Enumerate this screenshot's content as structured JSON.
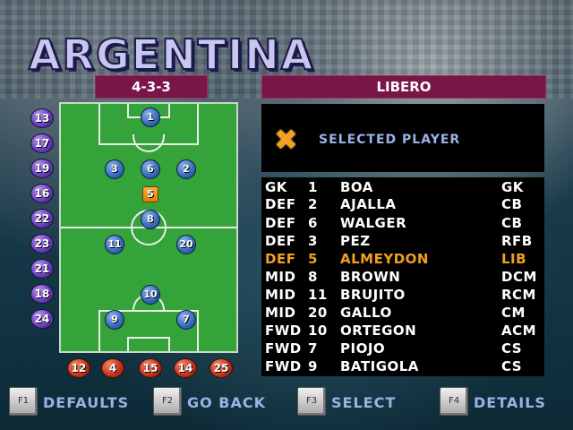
{
  "team_name": "ARGENTINA",
  "formation": "4-3-3",
  "selected_role": "LIBERO",
  "selected_panel": {
    "label": "SELECTED PLAYER",
    "icon": "star-icon"
  },
  "pitch_players": [
    "1",
    "3",
    "6",
    "2",
    "5",
    "8",
    "11",
    "20",
    "10",
    "9",
    "7"
  ],
  "subs": [
    "13",
    "17",
    "19",
    "16",
    "22",
    "23",
    "21",
    "18",
    "24"
  ],
  "reserves": [
    "12",
    "4",
    "15",
    "14",
    "25"
  ],
  "roster": [
    {
      "pos": "GK",
      "num": "1",
      "name": "BOA",
      "role": "GK",
      "highlight": false
    },
    {
      "pos": "DEF",
      "num": "2",
      "name": "AJALLA",
      "role": "CB",
      "highlight": false
    },
    {
      "pos": "DEF",
      "num": "6",
      "name": "WALGER",
      "role": "CB",
      "highlight": false
    },
    {
      "pos": "DEF",
      "num": "3",
      "name": "PEZ",
      "role": "RFB",
      "highlight": false
    },
    {
      "pos": "DEF",
      "num": "5",
      "name": "ALMEYDON",
      "role": "LIB",
      "highlight": true
    },
    {
      "pos": "MID",
      "num": "8",
      "name": "BROWN",
      "role": "DCM",
      "highlight": false
    },
    {
      "pos": "MID",
      "num": "11",
      "name": "BRUJITO",
      "role": "RCM",
      "highlight": false
    },
    {
      "pos": "MID",
      "num": "20",
      "name": "GALLO",
      "role": "CM",
      "highlight": false
    },
    {
      "pos": "FWD",
      "num": "10",
      "name": "ORTEGON",
      "role": "ACM",
      "highlight": false
    },
    {
      "pos": "FWD",
      "num": "7",
      "name": "PIOJO",
      "role": "CS",
      "highlight": false
    },
    {
      "pos": "FWD",
      "num": "9",
      "name": "BATIGOLA",
      "role": "CS",
      "highlight": false
    }
  ],
  "function_keys": [
    {
      "key": "F1",
      "label": "DEFAULTS"
    },
    {
      "key": "F2",
      "label": "GO BACK"
    },
    {
      "key": "F3",
      "label": "SELECT"
    },
    {
      "key": "F4",
      "label": "DETAILS"
    }
  ],
  "colors": {
    "bar": "#7a1547",
    "highlight": "#f0a020",
    "label": "#9bb2e6",
    "pitch": "#33a33a"
  }
}
